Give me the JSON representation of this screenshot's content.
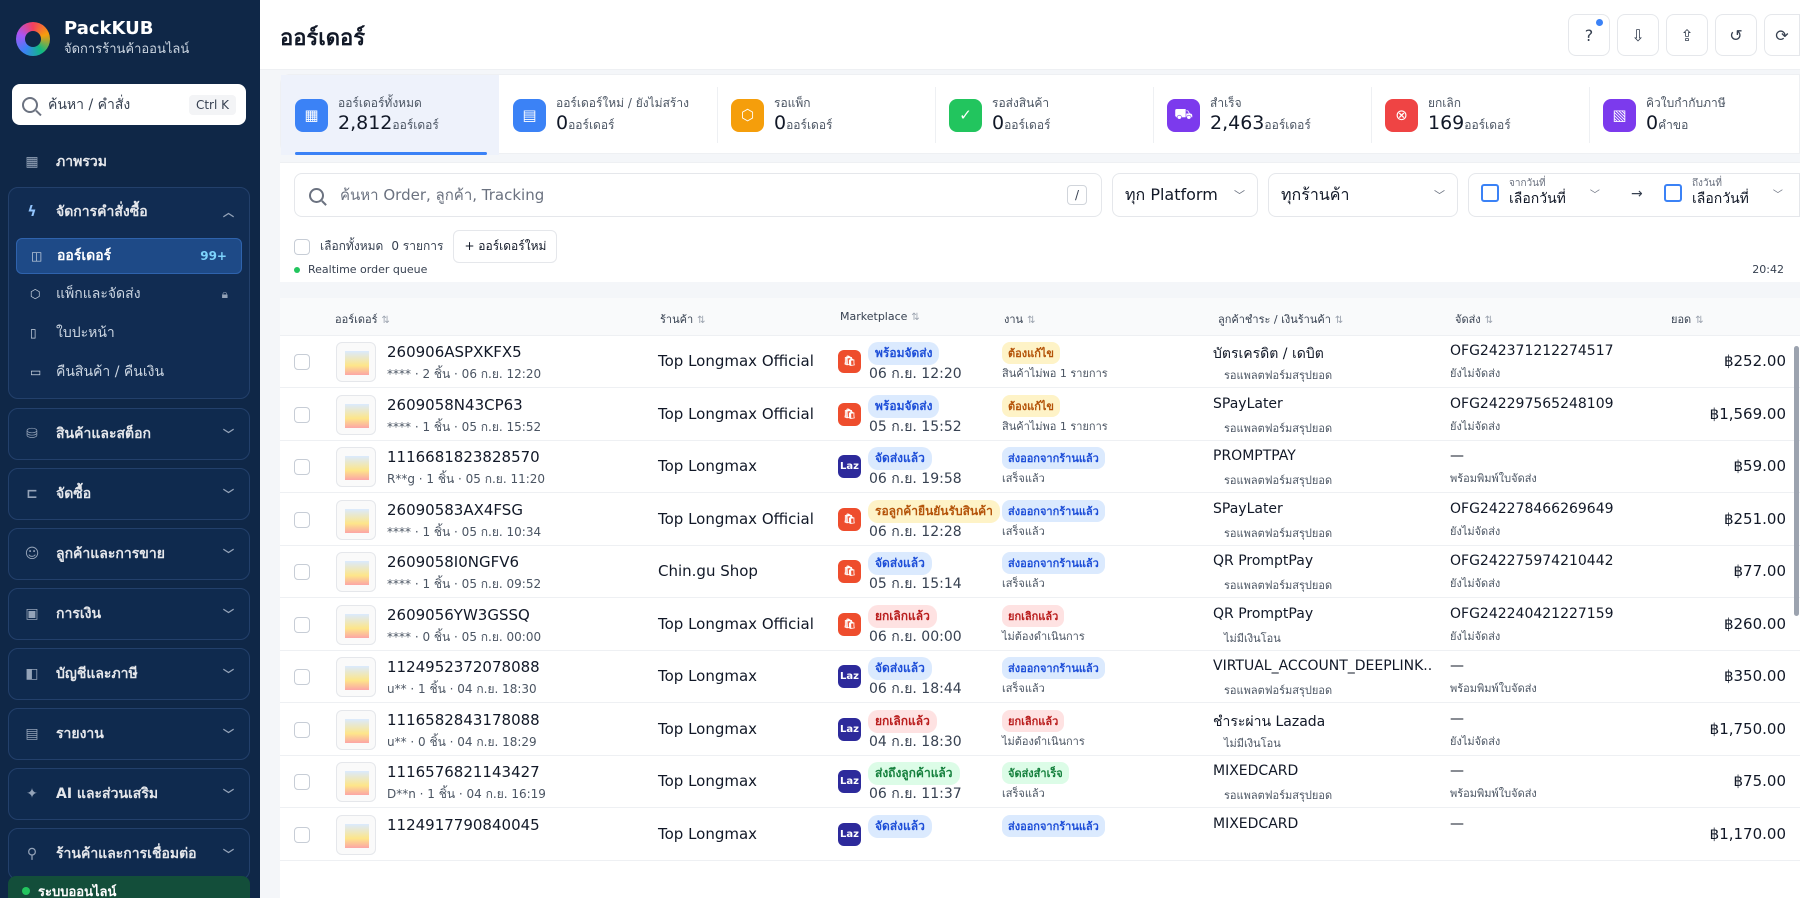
{
  "brand": {
    "name": "PackKUB",
    "subtitle": "จัดการร้านค้าออนไลน์"
  },
  "sidebar": {
    "search": {
      "placeholder": "ค้นหา / คำสั่ง",
      "shortcut": "Ctrl K"
    },
    "overview": "ภาพรวม",
    "order_group": {
      "label": "จัดการคำสั่งซื้อ",
      "items": [
        {
          "label": "ออร์เดอร์",
          "badge": "99+"
        },
        {
          "label": "แพ็กและจัดส่ง"
        },
        {
          "label": "ใบปะหน้า"
        },
        {
          "label": "คืนสินค้า / คืนเงิน"
        }
      ]
    },
    "groups": [
      {
        "label": "สินค้าและสต็อก"
      },
      {
        "label": "จัดซื้อ"
      },
      {
        "label": "ลูกค้าและการขาย"
      },
      {
        "label": "การเงิน"
      },
      {
        "label": "บัญชีและภาษี"
      },
      {
        "label": "รายงาน"
      },
      {
        "label": "AI และส่วนเสริม"
      },
      {
        "label": "ร้านค้าและการเชื่อมต่อ"
      }
    ],
    "status": "ระบบออนไลน์"
  },
  "header": {
    "title": "ออร์เดอร์"
  },
  "stats": [
    {
      "label": "ออร์เดอร์ทั้งหมด",
      "value": "2,812",
      "unit": "ออร์เดอร์",
      "color": "#3b82f6"
    },
    {
      "label": "ออร์เดอร์ใหม่ / ยังไม่สร้าง",
      "value": "0",
      "unit": "ออร์เดอร์",
      "color": "#3b82f6"
    },
    {
      "label": "รอแพ็ก",
      "value": "0",
      "unit": "ออร์เดอร์",
      "color": "#f59e0b"
    },
    {
      "label": "รอส่งสินค้า",
      "value": "0",
      "unit": "ออร์เดอร์",
      "color": "#22c55e"
    },
    {
      "label": "สำเร็จ",
      "value": "2,463",
      "unit": "ออร์เดอร์",
      "color": "#7c3aed"
    },
    {
      "label": "ยกเลิก",
      "value": "169",
      "unit": "ออร์เดอร์",
      "color": "#ef4444"
    },
    {
      "label": "คิวใบกำกับภาษี",
      "value": "0",
      "unit": "คำขอ",
      "color": "#7c3aed"
    }
  ],
  "filters": {
    "search_placeholder": "ค้นหา Order, ลูกค้า, Tracking",
    "search_shortcut": "/",
    "platform": "ทุก Platform",
    "shop": "ทุกร้านค้า",
    "date_from_label": "จากวันที่",
    "date_from_value": "เลือกวันที่",
    "date_to_label": "ถึงวันที่",
    "date_to_value": "เลือกวันที่",
    "date_arrow": "→",
    "select_all": "เลือกทั้งหมด",
    "selected_count": "0 รายการ",
    "new_order": "+ ออร์เดอร์ใหม่",
    "realtime": "Realtime order queue",
    "time": "20:42"
  },
  "table": {
    "headers": [
      "ออร์เดอร์",
      "ร้านค้า",
      "Marketplace",
      "งาน",
      "ลูกค้าชำระ / เงินร้านค้า",
      "จัดส่ง",
      "ยอด"
    ],
    "rows": [
      {
        "id": "260906ASPXKFX5",
        "sub": "**** · 2 ชิ้น · 06 ก.ย. 12:20",
        "shop": "Top Longmax Official",
        "mp": "shopee",
        "mp_badge": "พร้อมจัดส่ง",
        "mp_badge_tone": "blue",
        "mp_time": "06 ก.ย. 12:20",
        "task": "ต้องแก้ไข",
        "task_tone": "orange",
        "task_sub": "สินค้าไม่พอ 1 รายการ",
        "pay": "บัตรเครดิต / เดบิต",
        "pay_status": "รอแพลตฟอร์มสรุปยอด",
        "tracking": "OFG242371212274517",
        "ship_status": "ยังไม่จัดส่ง",
        "amount": "฿252.00"
      },
      {
        "id": "2609058N43CP63",
        "sub": "**** · 1 ชิ้น · 05 ก.ย. 15:52",
        "shop": "Top Longmax Official",
        "mp": "shopee",
        "mp_badge": "พร้อมจัดส่ง",
        "mp_badge_tone": "blue",
        "mp_time": "05 ก.ย. 15:52",
        "task": "ต้องแก้ไข",
        "task_tone": "orange",
        "task_sub": "สินค้าไม่พอ 1 รายการ",
        "pay": "SPayLater",
        "pay_status": "รอแพลตฟอร์มสรุปยอด",
        "tracking": "OFG242297565248109",
        "ship_status": "ยังไม่จัดส่ง",
        "amount": "฿1,569.00"
      },
      {
        "id": "1116681823828570",
        "sub": "R**g · 1 ชิ้น · 05 ก.ย. 11:20",
        "shop": "Top Longmax",
        "mp": "lazada",
        "mp_badge": "จัดส่งแล้ว",
        "mp_badge_tone": "blue",
        "mp_time": "06 ก.ย. 19:58",
        "task": "ส่งออกจากร้านแล้ว",
        "task_tone": "blue",
        "task_sub": "เสร็จแล้ว",
        "pay": "PROMPTPAY",
        "pay_status": "รอแพลตฟอร์มสรุปยอด",
        "tracking": "—",
        "ship_status": "พร้อมพิมพ์ใบจัดส่ง",
        "amount": "฿59.00"
      },
      {
        "id": "26090583AX4FSG",
        "sub": "**** · 1 ชิ้น · 05 ก.ย. 10:34",
        "shop": "Top Longmax Official",
        "mp": "shopee",
        "mp_badge": "รอลูกค้ายืนยันรับสินค้า",
        "mp_badge_tone": "orange",
        "mp_time": "06 ก.ย. 12:28",
        "task": "ส่งออกจากร้านแล้ว",
        "task_tone": "blue",
        "task_sub": "เสร็จแล้ว",
        "pay": "SPayLater",
        "pay_status": "รอแพลตฟอร์มสรุปยอด",
        "tracking": "OFG242278466269649",
        "ship_status": "ยังไม่จัดส่ง",
        "amount": "฿251.00"
      },
      {
        "id": "2609058I0NGFV6",
        "sub": "**** · 1 ชิ้น · 05 ก.ย. 09:52",
        "shop": "Chin.gu Shop",
        "mp": "shopee",
        "mp_badge": "จัดส่งแล้ว",
        "mp_badge_tone": "blue",
        "mp_time": "05 ก.ย. 15:14",
        "task": "ส่งออกจากร้านแล้ว",
        "task_tone": "blue",
        "task_sub": "เสร็จแล้ว",
        "pay": "QR PromptPay",
        "pay_status": "รอแพลตฟอร์มสรุปยอด",
        "tracking": "OFG242275974210442",
        "ship_status": "ยังไม่จัดส่ง",
        "amount": "฿77.00"
      },
      {
        "id": "2609056YW3GSSQ",
        "sub": "**** · 0 ชิ้น · 05 ก.ย. 00:00",
        "shop": "Top Longmax Official",
        "mp": "shopee",
        "mp_badge": "ยกเลิกแล้ว",
        "mp_badge_tone": "red",
        "mp_time": "06 ก.ย. 00:00",
        "task": "ยกเลิกแล้ว",
        "task_tone": "red",
        "task_sub": "ไม่ต้องดำเนินการ",
        "pay": "QR PromptPay",
        "pay_status": "ไม่มีเงินโอน",
        "tracking": "OFG242240421227159",
        "ship_status": "ยังไม่จัดส่ง",
        "amount": "฿260.00"
      },
      {
        "id": "1124952372078088",
        "sub": "u** · 1 ชิ้น · 04 ก.ย. 18:30",
        "shop": "Top Longmax",
        "mp": "lazada",
        "mp_badge": "จัดส่งแล้ว",
        "mp_badge_tone": "blue",
        "mp_time": "06 ก.ย. 18:44",
        "task": "ส่งออกจากร้านแล้ว",
        "task_tone": "blue",
        "task_sub": "เสร็จแล้ว",
        "pay": "VIRTUAL_ACCOUNT_DEEPLINK...",
        "pay_status": "รอแพลตฟอร์มสรุปยอด",
        "tracking": "—",
        "ship_status": "พร้อมพิมพ์ใบจัดส่ง",
        "amount": "฿350.00"
      },
      {
        "id": "1116582843178088",
        "sub": "u** · 0 ชิ้น · 04 ก.ย. 18:29",
        "shop": "Top Longmax",
        "mp": "lazada",
        "mp_badge": "ยกเลิกแล้ว",
        "mp_badge_tone": "red",
        "mp_time": "04 ก.ย. 18:30",
        "task": "ยกเลิกแล้ว",
        "task_tone": "red",
        "task_sub": "ไม่ต้องดำเนินการ",
        "pay": "ชำระผ่าน Lazada",
        "pay_status": "ไม่มีเงินโอน",
        "tracking": "—",
        "ship_status": "ยังไม่จัดส่ง",
        "amount": "฿1,750.00"
      },
      {
        "id": "1116576821143427",
        "sub": "D**n · 1 ชิ้น · 04 ก.ย. 16:19",
        "shop": "Top Longmax",
        "mp": "lazada",
        "mp_badge": "ส่งถึงลูกค้าแล้ว",
        "mp_badge_tone": "green",
        "mp_time": "06 ก.ย. 11:37",
        "task": "จัดส่งสำเร็จ",
        "task_tone": "green",
        "task_sub": "เสร็จแล้ว",
        "pay": "MIXEDCARD",
        "pay_status": "รอแพลตฟอร์มสรุปยอด",
        "tracking": "—",
        "ship_status": "พร้อมพิมพ์ใบจัดส่ง",
        "amount": "฿75.00"
      },
      {
        "id": "1124917790840045",
        "sub": "",
        "shop": "Top Longmax",
        "mp": "lazada",
        "mp_badge": "จัดส่งแล้ว",
        "mp_badge_tone": "blue",
        "mp_time": "",
        "task": "ส่งออกจากร้านแล้ว",
        "task_tone": "blue",
        "task_sub": "",
        "pay": "MIXEDCARD",
        "pay_status": "",
        "tracking": "—",
        "ship_status": "",
        "amount": "฿1,170.00"
      }
    ]
  },
  "colors": {
    "shopee": "#ee4d2d",
    "lazada": "#2d2a9b",
    "sidebar": "#0f2747",
    "accent": "#3b82f6"
  }
}
